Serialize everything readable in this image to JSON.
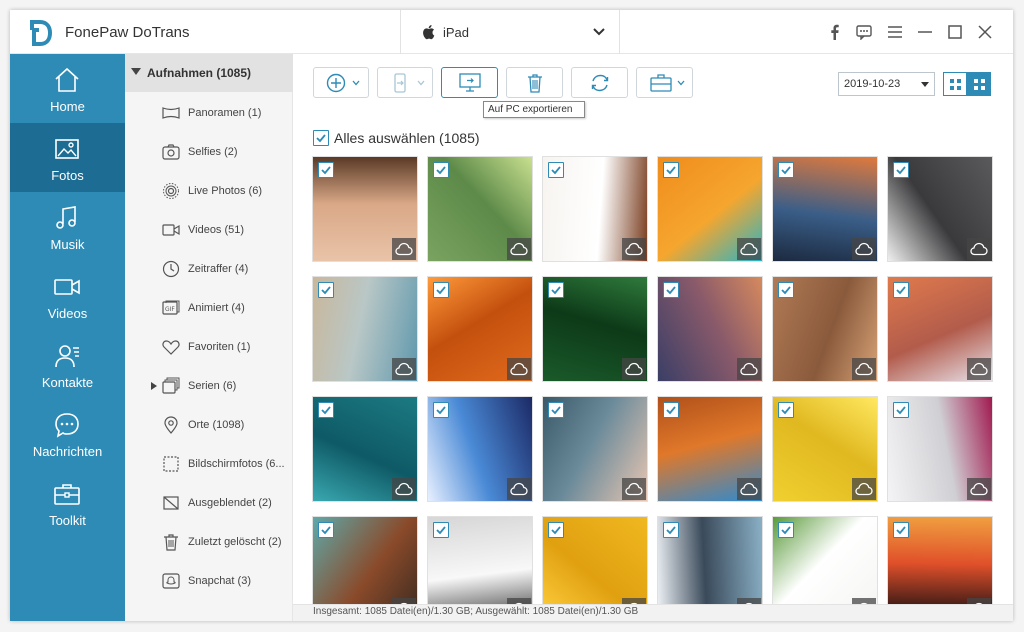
{
  "app": {
    "title": "FonePaw DoTrans"
  },
  "device": {
    "name": "iPad"
  },
  "nav": [
    {
      "label": "Home",
      "icon": "home-icon",
      "active": false
    },
    {
      "label": "Fotos",
      "icon": "photo-icon",
      "active": true
    },
    {
      "label": "Musik",
      "icon": "music-icon",
      "active": false
    },
    {
      "label": "Videos",
      "icon": "video-icon",
      "active": false
    },
    {
      "label": "Kontakte",
      "icon": "contacts-icon",
      "active": false
    },
    {
      "label": "Nachrichten",
      "icon": "message-icon",
      "active": false
    },
    {
      "label": "Toolkit",
      "icon": "toolkit-icon",
      "active": false
    }
  ],
  "albums": {
    "header": "Aufnahmen (1085)",
    "items": [
      {
        "label": "Panoramen (1)",
        "icon": "panorama-icon"
      },
      {
        "label": "Selfies (2)",
        "icon": "selfie-icon"
      },
      {
        "label": "Live Photos (6)",
        "icon": "live-photo-icon"
      },
      {
        "label": "Videos (51)",
        "icon": "video-icon"
      },
      {
        "label": "Zeitraffer (4)",
        "icon": "timelapse-icon"
      },
      {
        "label": "Animiert (4)",
        "icon": "gif-icon"
      },
      {
        "label": "Favoriten (1)",
        "icon": "heart-icon"
      },
      {
        "label": "Serien (6)",
        "icon": "burst-icon"
      },
      {
        "label": "Orte (1098)",
        "icon": "location-icon"
      },
      {
        "label": "Bildschirmfotos (6...",
        "icon": "screenshot-icon"
      },
      {
        "label": "Ausgeblendet (2)",
        "icon": "hidden-icon"
      },
      {
        "label": "Zuletzt gelöscht (2)",
        "icon": "trash-icon"
      },
      {
        "label": "Snapchat (3)",
        "icon": "snapchat-icon"
      }
    ]
  },
  "toolbar": {
    "tooltip": "Auf PC exportieren",
    "date": "2019-10-23"
  },
  "select_all": "Alles auswählen (1085)",
  "status": "Insgesamt: 1085 Datei(en)/1.30 GB; Ausgewählt: 1085 Datei(en)/1.30 GB",
  "colors": {
    "accent": "#2e8bb6",
    "nav_active": "#1c6c93"
  },
  "photos": [
    {
      "subject": "coffee-cup",
      "colors": [
        "#e9c3a8",
        "#d9a887",
        "#5a3a26"
      ]
    },
    {
      "subject": "green-carnation",
      "colors": [
        "#7aa360",
        "#5d8a49",
        "#c9e08f"
      ]
    },
    {
      "subject": "coffee-beans-leaves",
      "colors": [
        "#f7f4f0",
        "#ffffff",
        "#7a3e20"
      ]
    },
    {
      "subject": "banana-beach-towel",
      "colors": [
        "#f08c1c",
        "#f5a62e",
        "#25b4c9"
      ]
    },
    {
      "subject": "abstract-pattern",
      "colors": [
        "#e07a3c",
        "#3a5e88",
        "#1c2a40"
      ]
    },
    {
      "subject": "paint-texture",
      "colors": [
        "#5a5a5c",
        "#3a3a3c",
        "#f0f0f0"
      ]
    },
    {
      "subject": "beach-aerial",
      "colors": [
        "#5f98ad",
        "#b9c7c6",
        "#c9b79b"
      ]
    },
    {
      "subject": "orange-brick",
      "colors": [
        "#e06a1c",
        "#c4500e",
        "#ff9a3a"
      ]
    },
    {
      "subject": "green-leaves",
      "colors": [
        "#1a5a2a",
        "#0d3a18",
        "#2f7a3c"
      ]
    },
    {
      "subject": "dusk-sky",
      "colors": [
        "#3a3e66",
        "#8a5a6a",
        "#d68a5e"
      ]
    },
    {
      "subject": "sand-texture",
      "colors": [
        "#b07a55",
        "#8a5a3c",
        "#d6a276"
      ]
    },
    {
      "subject": "dunes-sunset",
      "colors": [
        "#e07a4c",
        "#b25c4c",
        "#e8e2ea"
      ]
    },
    {
      "subject": "teal-circles",
      "colors": [
        "#1c7a82",
        "#0e5a66",
        "#3aa8b0"
      ]
    },
    {
      "subject": "blue-jellyfish",
      "colors": [
        "#1c2a66",
        "#4a8ad6",
        "#e8f0ff"
      ]
    },
    {
      "subject": "ocean-waves",
      "colors": [
        "#e8c6b2",
        "#6a8a9a",
        "#3a5a6a"
      ]
    },
    {
      "subject": "orange-dune",
      "colors": [
        "#2e8ad0",
        "#e0782a",
        "#b0501a"
      ]
    },
    {
      "subject": "yellow-flower",
      "colors": [
        "#f0d030",
        "#e0b820",
        "#ffe860"
      ]
    },
    {
      "subject": "white-car",
      "colors": [
        "#f4f4f6",
        "#d0d0d4",
        "#a01a50"
      ]
    },
    {
      "subject": "building-sky",
      "colors": [
        "#5fa8a8",
        "#8a4a2a",
        "#3a2a20"
      ]
    },
    {
      "subject": "snowy-rocks",
      "colors": [
        "#d6d6d6",
        "#f8f8f8",
        "#3a3a3a"
      ]
    },
    {
      "subject": "yellow-wood",
      "colors": [
        "#f0b820",
        "#e0a010",
        "#ffd040"
      ]
    },
    {
      "subject": "mountain-range",
      "colors": [
        "#8ab0c6",
        "#3a4a5a",
        "#eef2f6"
      ]
    },
    {
      "subject": "white-orchid",
      "colors": [
        "#f4f4f2",
        "#ffffff",
        "#5a9a3a"
      ]
    },
    {
      "subject": "fireworks",
      "colors": [
        "#0a0a10",
        "#e0502a",
        "#f0a040"
      ]
    }
  ]
}
